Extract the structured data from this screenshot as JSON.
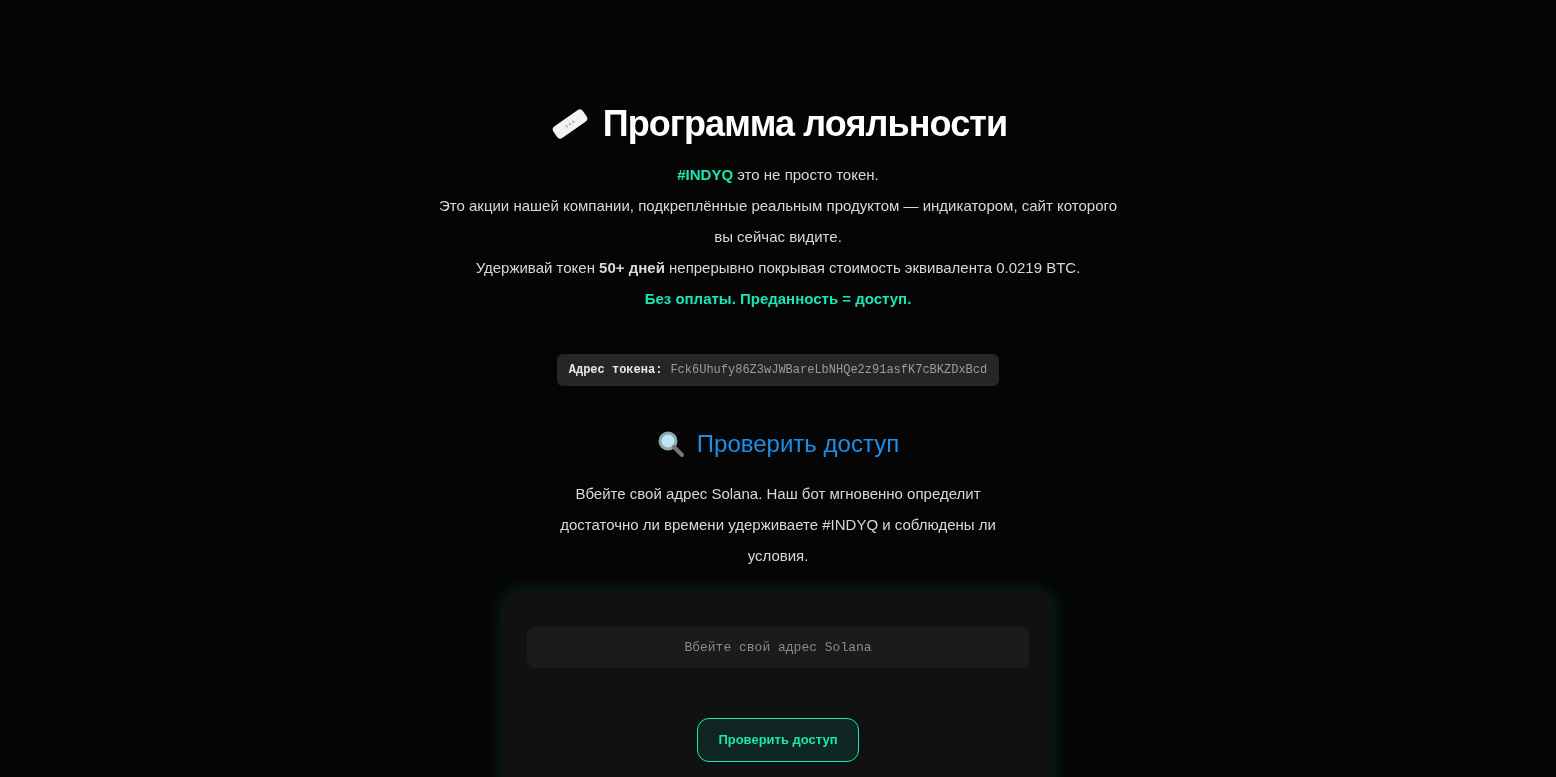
{
  "title": "Программа лояльности",
  "intro": {
    "tag": "#INDYQ",
    "tag_rest": "это не просто токен.",
    "lines": [
      "Это акции нашей компании, подкреплённые реальным продуктом — индикатором, сайт которого вы сейчас видите.",
      "Удерживай токен **50+ дней** непрерывно покрывая стоимость эквивалента 0.0219 BTC."
    ],
    "highlight": "Без оплаты. Преданность = доступ."
  },
  "token": {
    "label": "Адрес токена:",
    "address": "Fck6Uhufy86Z3wJWBareLbNHQe2z91asfK7cBKZDxBcd"
  },
  "check": {
    "heading": "Проверить доступ",
    "description": "Вбейте свой адрес Solana. Наш бот мгновенно определит достаточно ли времени удерживаете #INDYQ и соблюдены ли условия.",
    "input": {
      "placeholder": "Вбейте свой адрес Solana"
    },
    "button": "Проверить доступ"
  }
}
